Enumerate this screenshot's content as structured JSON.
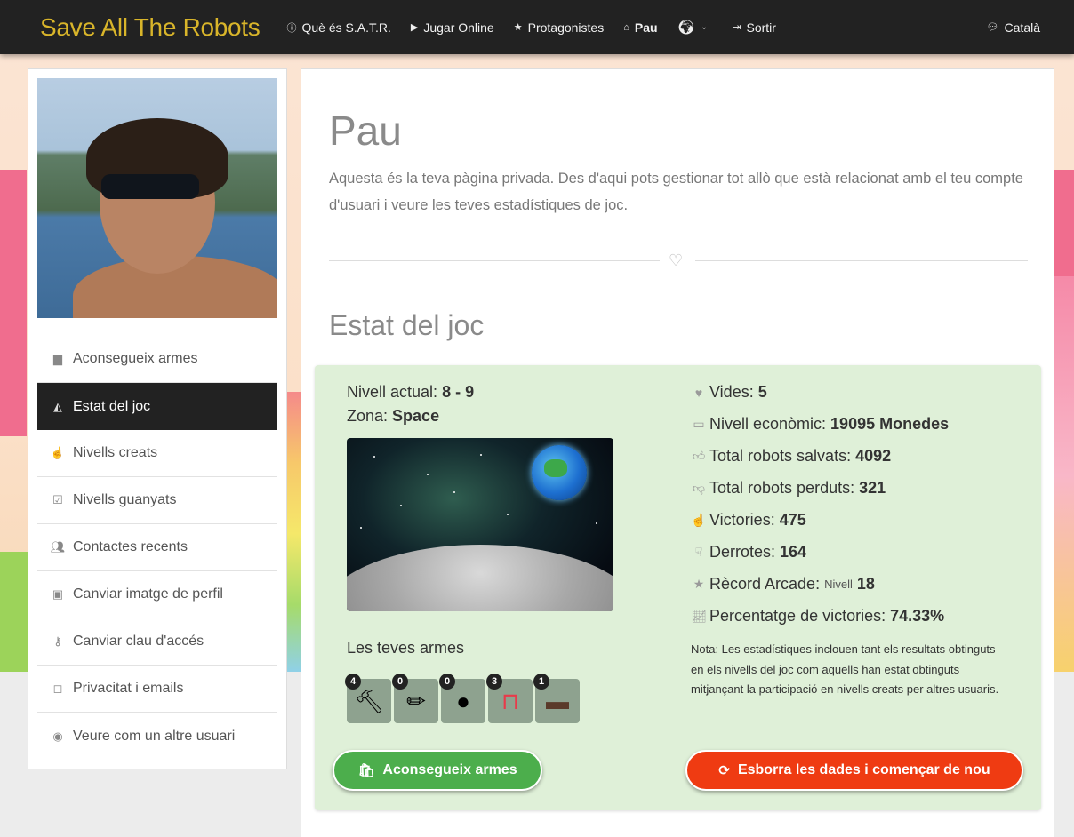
{
  "navbar": {
    "brand": "Save All The Robots",
    "items": [
      {
        "icon": "info-icon",
        "label": "Què és S.A.T.R."
      },
      {
        "icon": "play-icon",
        "label": "Jugar Online"
      },
      {
        "icon": "star-icon",
        "label": "Protagonistes"
      },
      {
        "icon": "home-icon",
        "label": "Pau"
      },
      {
        "icon": "globe-icon",
        "label": ""
      },
      {
        "icon": "logout-icon",
        "label": "Sortir"
      }
    ],
    "language": "Català"
  },
  "sidebar": {
    "items": [
      {
        "icon": "shopping-bag-icon",
        "label": "Aconsegueix armes"
      },
      {
        "icon": "area-chart-icon",
        "label": "Estat del joc"
      },
      {
        "icon": "hand-pointer-icon",
        "label": "Nivells creats"
      },
      {
        "icon": "check-square-icon",
        "label": "Nivells guanyats"
      },
      {
        "icon": "users-icon",
        "label": "Contactes recents"
      },
      {
        "icon": "picture-icon",
        "label": "Canviar imatge de perfil"
      },
      {
        "icon": "key-icon",
        "label": "Canviar clau d'accés"
      },
      {
        "icon": "sticky-note-icon",
        "label": "Privacitat i emails"
      },
      {
        "icon": "eye-slash-icon",
        "label": "Veure com un altre usuari"
      }
    ]
  },
  "main": {
    "title": "Pau",
    "intro": "Aquesta és la teva pàgina privada. Des d'aqui pots gestionar tot allò que està relacionat amb el teu compte d'usuari i veure les teves estadístiques de joc.",
    "section_title": "Estat del joc",
    "level_label": "Nivell actual:",
    "level_value": "8 - 9",
    "zone_label": "Zona:",
    "zone_value": "Space",
    "weapons_title": "Les teves armes",
    "weapons": [
      {
        "name": "hammer-icon",
        "count": "4"
      },
      {
        "name": "pencil-icon",
        "count": "0"
      },
      {
        "name": "bomb-icon",
        "count": "0"
      },
      {
        "name": "magnet-icon",
        "count": "3"
      },
      {
        "name": "cannon-icon",
        "count": "1"
      }
    ],
    "stats": {
      "lives_label": "Vides:",
      "lives_value": "5",
      "economy_label": "Nivell econòmic:",
      "economy_value": "19095 Monedes",
      "saved_label": "Total robots salvats:",
      "saved_value": "4092",
      "lost_label": "Total robots perduts:",
      "lost_value": "321",
      "wins_label": "Victories:",
      "wins_value": "475",
      "defeats_label": "Derrotes:",
      "defeats_value": "164",
      "arcade_label": "Rècord Arcade:",
      "arcade_small": "Nivell",
      "arcade_value": "18",
      "pct_label": "Percentatge de victories:",
      "pct_value": "74.33%"
    },
    "note": "Nota: Les estadístiques inclouen tant els resultats obtinguts en els nivells del joc com aquells han estat obtinguts mitjançant la participació en nivells creats per altres usuaris.",
    "btn_get_weapons": "Aconsegueix armes",
    "btn_reset": "Esborra les dades i començar de nou"
  },
  "colors": {
    "brand": "#d9b52a",
    "navbar_bg": "#222222",
    "stats_bg": "#dff0d8",
    "btn_green": "#4cae4c",
    "btn_red": "#ef3b12"
  }
}
